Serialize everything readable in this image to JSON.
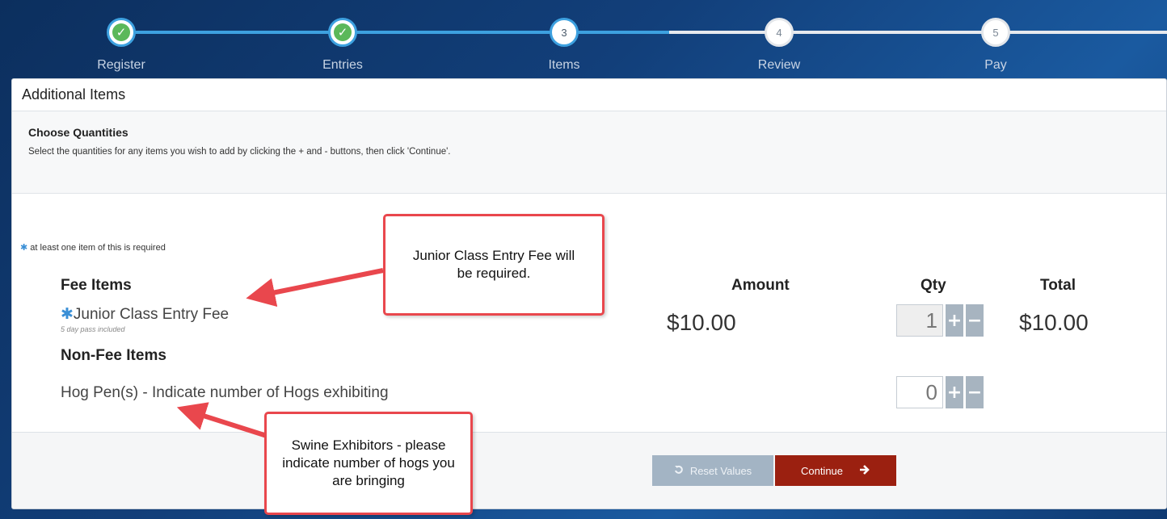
{
  "stepper": {
    "steps": [
      {
        "label": "Register",
        "number": "1",
        "state": "done"
      },
      {
        "label": "Entries",
        "number": "2",
        "state": "done"
      },
      {
        "label": "Items",
        "number": "3",
        "state": "current"
      },
      {
        "label": "Review",
        "number": "4",
        "state": "future"
      },
      {
        "label": "Pay",
        "number": "5",
        "state": "future"
      }
    ],
    "check_glyph": "✓"
  },
  "panel": {
    "title": "Additional Items",
    "instructions": {
      "title": "Choose Quantities",
      "text": "Select the quantities for any items you wish to add by clicking the + and - buttons, then click 'Continue'."
    },
    "required_note": "at least one item of this is required",
    "required_star": "✱",
    "fee_items": {
      "heading": "Fee Items",
      "items": [
        {
          "name": "Junior Class Entry Fee",
          "subtext": "5 day pass included",
          "amount": "$10.00",
          "qty": "1",
          "total": "$10.00"
        }
      ]
    },
    "non_fee_items": {
      "heading": "Non-Fee Items",
      "items": [
        {
          "name": "Hog Pen(s) - Indicate number of Hogs exhibiting",
          "qty": "0"
        }
      ]
    },
    "columns": {
      "amount": "Amount",
      "qty": "Qty",
      "total": "Total"
    },
    "plus": "+",
    "minus": "−",
    "footer": {
      "reset_label": "Reset Values",
      "continue_label": "Continue"
    }
  },
  "callouts": {
    "junior": "Junior Class Entry Fee will be required.",
    "swine": "Swine Exhibitors - please indicate number of hogs you are bringing"
  },
  "colors": {
    "accent_blue": "#3da1e0",
    "check_green": "#5bb85a",
    "continue_red": "#9b2010",
    "callout_border": "#e9474d"
  }
}
